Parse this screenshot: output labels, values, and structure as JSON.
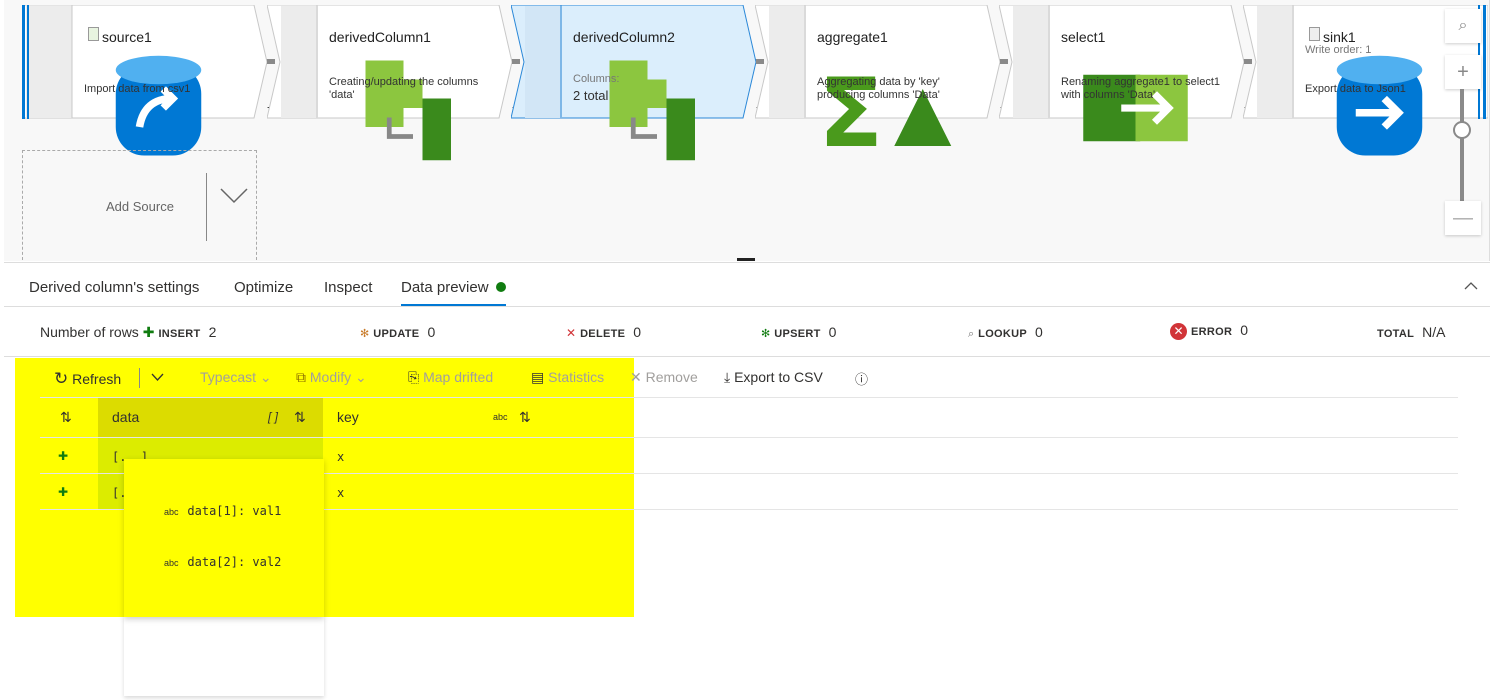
{
  "pipeline": {
    "nodes": [
      {
        "title": "source1",
        "desc": "Import data from csv1",
        "icon": "source-db-icon",
        "type": "source"
      },
      {
        "title": "derivedColumn1",
        "desc": "Creating/updating the columns 'data'",
        "icon": "derived-column-icon"
      },
      {
        "title": "derivedColumn2",
        "columns_label": "Columns:",
        "columns_value": "2 total",
        "icon": "derived-column-icon",
        "selected": true
      },
      {
        "title": "aggregate1",
        "desc": "Aggregating data by 'key' producing columns 'Data'",
        "icon": "aggregate-icon"
      },
      {
        "title": "select1",
        "desc": "Renaming aggregate1 to select1 with columns 'Data'",
        "icon": "select-icon"
      },
      {
        "title": "sink1",
        "write_order": "Write order: 1",
        "desc": "Export data to Json1",
        "icon": "sink-db-icon",
        "type": "sink"
      }
    ],
    "add_plus": "+",
    "add_source": "Add Source",
    "zoom": {
      "search": "⌕",
      "in": "+",
      "out": "—",
      "level": 0.8
    }
  },
  "tabs": [
    {
      "label": "Derived column's settings"
    },
    {
      "label": "Optimize"
    },
    {
      "label": "Inspect"
    },
    {
      "label": "Data preview",
      "active": true
    }
  ],
  "counts": {
    "label": "Number of rows",
    "insert": {
      "label": "INSERT",
      "value": "2"
    },
    "update": {
      "label": "UPDATE",
      "value": "0"
    },
    "delete": {
      "label": "DELETE",
      "value": "0"
    },
    "upsert": {
      "label": "UPSERT",
      "value": "0"
    },
    "lookup": {
      "label": "LOOKUP",
      "value": "0"
    },
    "error": {
      "label": "ERROR",
      "value": "0"
    },
    "total": {
      "label": "TOTAL",
      "value": "N/A"
    }
  },
  "toolbar": {
    "refresh": "Refresh",
    "typecast": "Typecast",
    "modify": "Modify",
    "map_drifted": "Map drifted",
    "statistics": "Statistics",
    "remove": "Remove",
    "export": "Export to CSV"
  },
  "table": {
    "columns": [
      {
        "name": "data",
        "type": "[ ]"
      },
      {
        "name": "key",
        "type": "abc"
      }
    ],
    "rows": [
      {
        "data": "[...]",
        "key": "x"
      },
      {
        "data": "[...]",
        "key": "x"
      }
    ]
  },
  "popup": {
    "items": [
      {
        "type": "abc",
        "text": "data[1]: val1"
      },
      {
        "type": "abc",
        "text": "data[2]: val2"
      }
    ]
  },
  "colors": {
    "accent": "#0078d4",
    "selected_node": "#dbeefc",
    "highlight": "#ffff00",
    "insert": "#107c10",
    "error": "#d13438"
  }
}
